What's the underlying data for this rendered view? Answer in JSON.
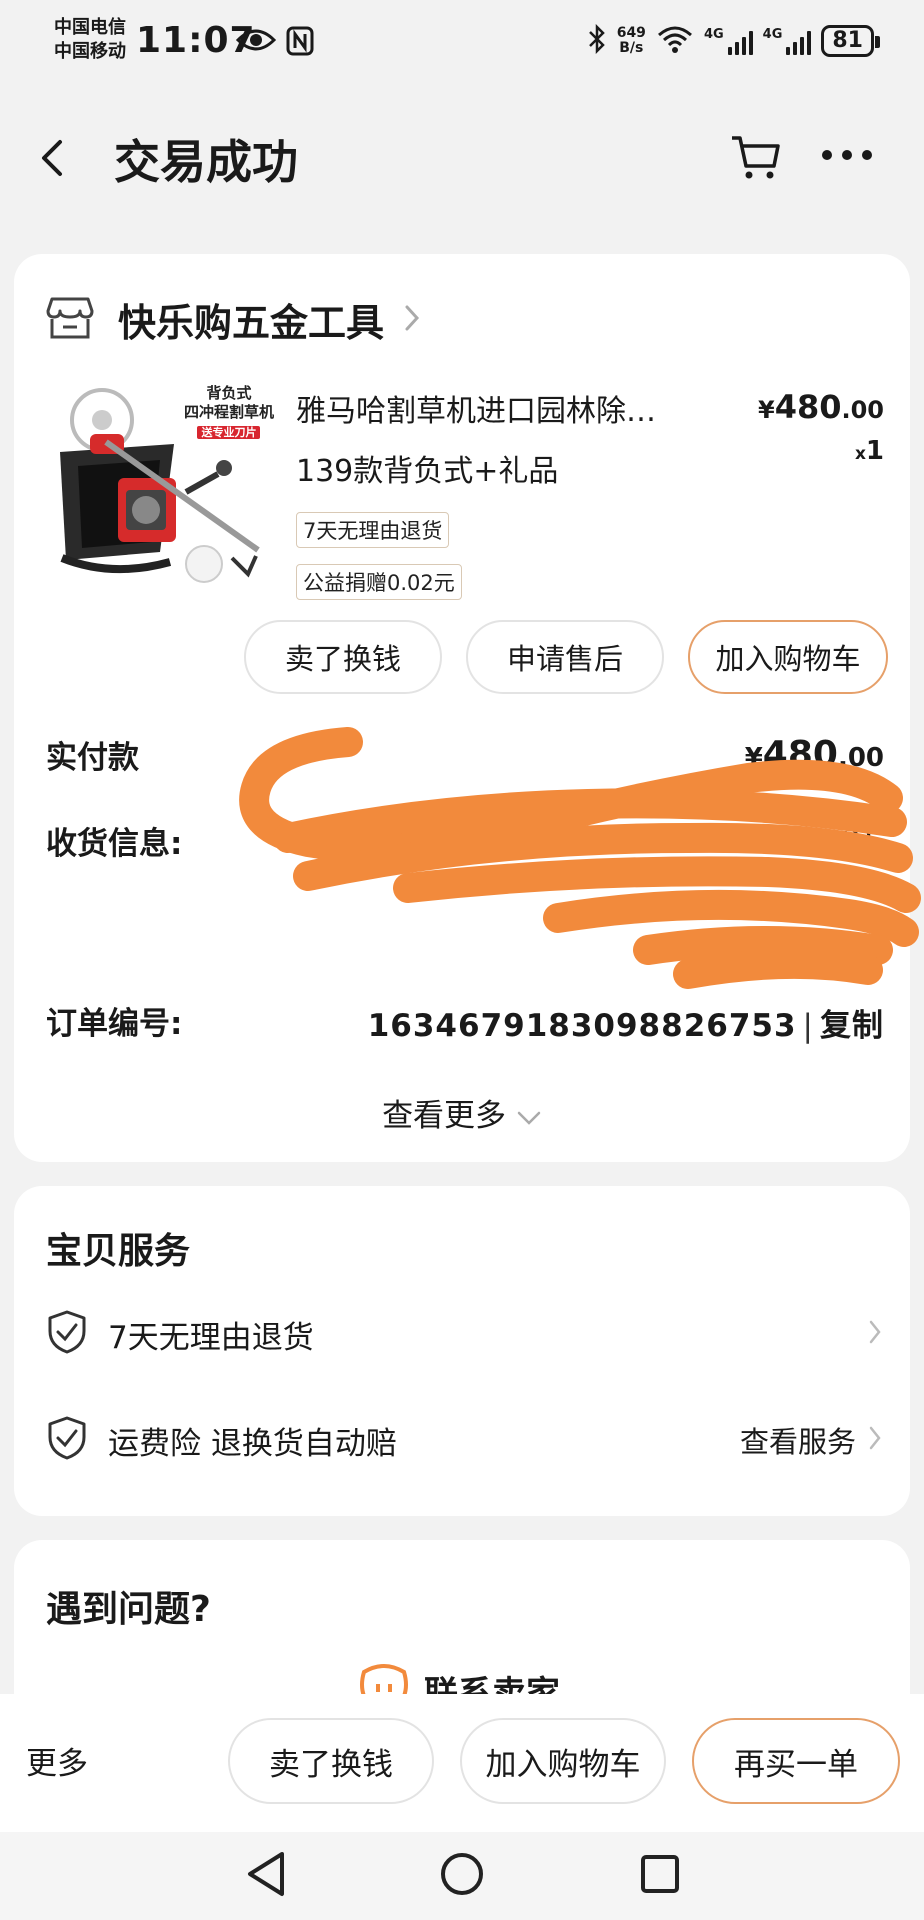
{
  "status_bar": {
    "carrier1": "中国电信",
    "carrier2": "中国移动",
    "time": "11:07",
    "net_speed_value": "649",
    "net_speed_unit": "B/s",
    "sig1_label": "4G",
    "sig2_label": "4G",
    "battery": "81"
  },
  "header": {
    "title": "交易成功"
  },
  "shop": {
    "name": "快乐购五金工具"
  },
  "product": {
    "title_line1": "雅马哈割草机进口园林除…",
    "title_line2": "139款背负式+礼品",
    "price_symbol": "¥",
    "price_int": "480",
    "price_dec": ".00",
    "qty_x": "x",
    "qty_num": "1",
    "tag_return": "7天无理由退货",
    "tag_charity": "公益捐赠0.02元",
    "image_text_1": "背负式",
    "image_text_2": "四冲程割草机",
    "image_text_3": "送专业刀片"
  },
  "item_actions": {
    "sell": "卖了换钱",
    "after_sale": "申请售后",
    "add_cart": "加入购物车"
  },
  "order": {
    "paid_label": "实付款",
    "paid_symbol": "¥",
    "paid_int": "480",
    "paid_dec": ".00",
    "shipping_label": "收货信息:",
    "shipping_visible_fragment": "西社",
    "order_no_label": "订单编号:",
    "order_no": "1634679183098826753",
    "order_sep": "|",
    "copy": "复制",
    "see_more": "查看更多"
  },
  "services": {
    "title": "宝贝服务",
    "item1": "7天无理由退货",
    "item2": "运费险 退换货自动赔",
    "item2_action": "查看服务"
  },
  "problems": {
    "title": "遇到问题?",
    "contact": "联系卖家"
  },
  "bottom_bar": {
    "more": "更多",
    "sell": "卖了换钱",
    "add_cart": "加入购物车",
    "rebuy": "再买一单"
  },
  "colors": {
    "accent_border": "#e6a06a",
    "scribble": "#f28a3c",
    "page_bg": "#f2f2f2"
  }
}
